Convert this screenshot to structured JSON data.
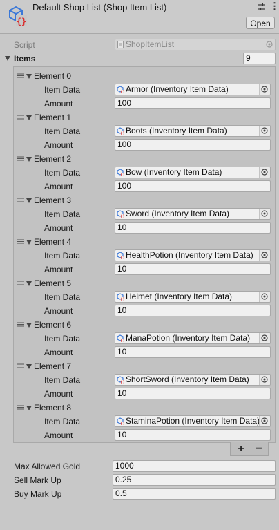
{
  "header": {
    "title": "Default Shop List (Shop Item List)",
    "open_label": "Open",
    "icon": "scriptable-object-icon",
    "more_glyph": "⋮"
  },
  "script_row": {
    "label": "Script",
    "value": "ShopItemList"
  },
  "items": {
    "label": "Items",
    "count": "9",
    "item_data_label": "Item Data",
    "amount_label": "Amount",
    "elements": [
      {
        "name": "Element 0",
        "item": "Armor (Inventory Item Data)",
        "amount": "100"
      },
      {
        "name": "Element 1",
        "item": "Boots (Inventory Item Data)",
        "amount": "100"
      },
      {
        "name": "Element 2",
        "item": "Bow (Inventory Item Data)",
        "amount": "100"
      },
      {
        "name": "Element 3",
        "item": "Sword (Inventory Item Data)",
        "amount": "10"
      },
      {
        "name": "Element 4",
        "item": "HealthPotion (Inventory Item Data)",
        "amount": "10"
      },
      {
        "name": "Element 5",
        "item": "Helmet (Inventory Item Data)",
        "amount": "10"
      },
      {
        "name": "Element 6",
        "item": "ManaPotion (Inventory Item Data)",
        "amount": "10"
      },
      {
        "name": "Element 7",
        "item": "ShortSword (Inventory Item Data)",
        "amount": "10"
      },
      {
        "name": "Element 8",
        "item": "StaminaPotion (Inventory Item Data)",
        "amount": "10"
      }
    ],
    "add_glyph": "+",
    "remove_glyph": "−"
  },
  "fields": {
    "max_gold": {
      "label": "Max Allowed Gold",
      "value": "1000"
    },
    "sell_markup": {
      "label": "Sell Mark Up",
      "value": "0.25"
    },
    "buy_markup": {
      "label": "Buy Mark Up",
      "value": "0.5"
    }
  },
  "colors": {
    "panel": "#c8c8c8",
    "field": "#f0f0f0",
    "icon_blue": "#3b78d8",
    "icon_red": "#d83030"
  }
}
